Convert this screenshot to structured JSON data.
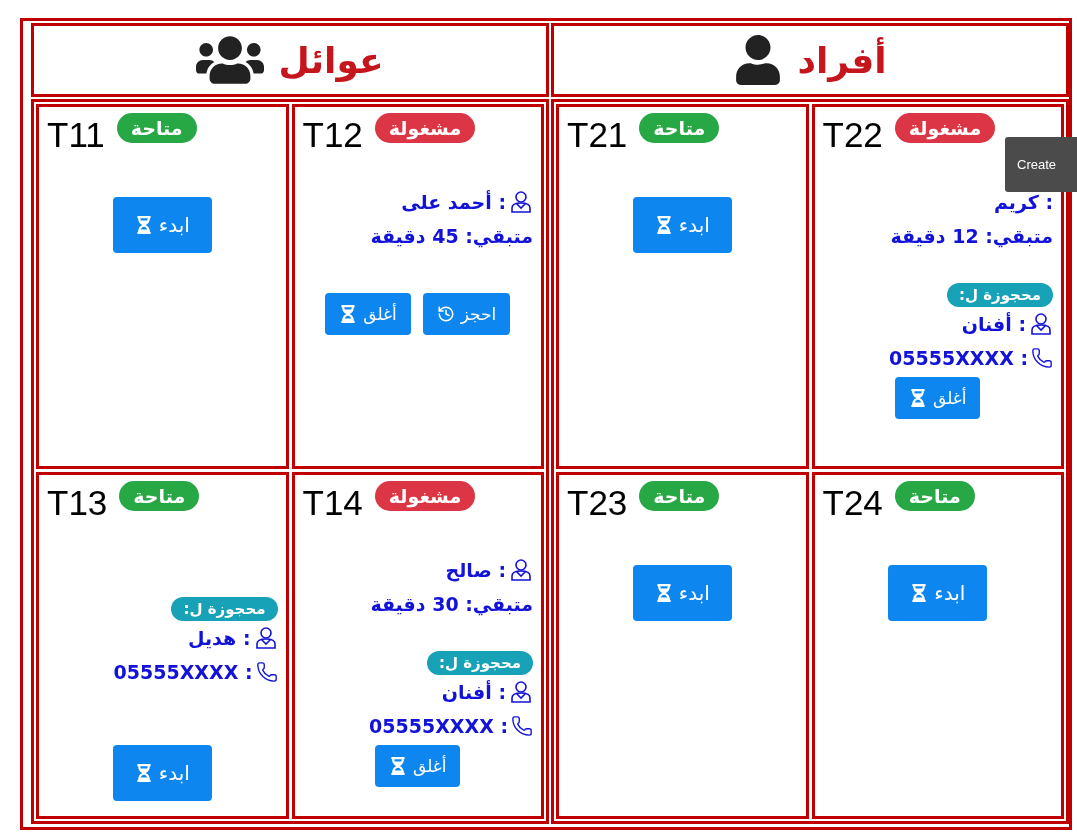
{
  "sections": [
    {
      "title": "أفراد",
      "kind": "individuals",
      "tables": [
        {
          "name": "T22",
          "status": {
            "label": "مشغولة",
            "kind": "occupied"
          },
          "occupant": {
            "name": ": كريم",
            "avatar": false,
            "remaining": "متبقي: 12 دقيقة"
          },
          "reservation": {
            "label": "محجوزة ل:",
            "name": ": أفنان",
            "phone": ": 05555XXXX"
          },
          "buttons": [
            {
              "label": "أغلق",
              "kind": "close"
            }
          ]
        },
        {
          "name": "T21",
          "status": {
            "label": "متاحة",
            "kind": "available"
          },
          "buttons": [
            {
              "label": "ابدء",
              "kind": "start"
            }
          ]
        },
        {
          "name": "T24",
          "status": {
            "label": "متاحة",
            "kind": "available"
          },
          "buttons": [
            {
              "label": "ابدء",
              "kind": "start"
            }
          ]
        },
        {
          "name": "T23",
          "status": {
            "label": "متاحة",
            "kind": "available"
          },
          "buttons": [
            {
              "label": "ابدء",
              "kind": "start"
            }
          ]
        }
      ]
    },
    {
      "title": "عوائل",
      "kind": "families",
      "tables": [
        {
          "name": "T12",
          "status": {
            "label": "مشغولة",
            "kind": "occupied"
          },
          "occupant": {
            "name": ": أحمد على",
            "avatar": true,
            "remaining": "متبقي: 45 دقيقة"
          },
          "buttons": [
            {
              "label": "احجز",
              "kind": "reserve"
            },
            {
              "label": "أغلق",
              "kind": "close"
            }
          ]
        },
        {
          "name": "T11",
          "status": {
            "label": "متاحة",
            "kind": "available"
          },
          "buttons": [
            {
              "label": "ابدء",
              "kind": "start"
            }
          ]
        },
        {
          "name": "T14",
          "status": {
            "label": "مشغولة",
            "kind": "occupied"
          },
          "occupant": {
            "name": ": صالح",
            "avatar": true,
            "remaining": "متبقي: 30 دقيقة"
          },
          "reservation": {
            "label": "محجوزة ل:",
            "name": ": أفنان",
            "phone": ": 05555XXXX"
          },
          "buttons": [
            {
              "label": "أغلق",
              "kind": "close"
            }
          ]
        },
        {
          "name": "T13",
          "status": {
            "label": "متاحة",
            "kind": "available"
          },
          "reservation": {
            "label": "محجوزة ل:",
            "name": ": هديل",
            "phone": ": 05555XXXX"
          },
          "buttons": [
            {
              "label": "ابدء",
              "kind": "start"
            }
          ]
        }
      ]
    }
  ],
  "tooltip": "Create"
}
